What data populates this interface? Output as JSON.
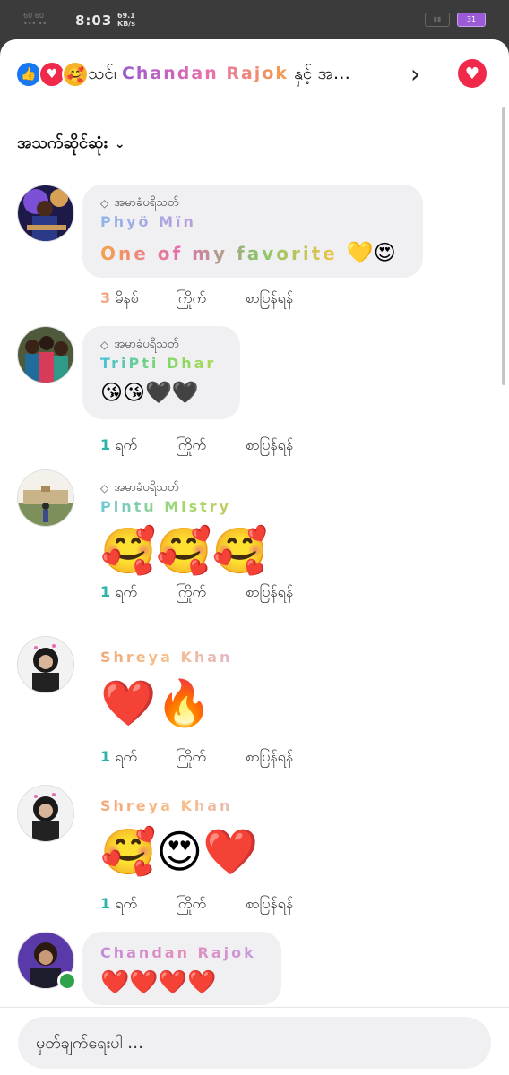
{
  "status_bar": {
    "left_small": "60 60\n••• ••",
    "time": "8:03",
    "net_speed_value": "69.1",
    "net_speed_unit": "KB/s",
    "battery": "31"
  },
  "header": {
    "reactions": [
      {
        "icon": "like-icon",
        "glyph": "👍"
      },
      {
        "icon": "love-icon",
        "glyph": "♥"
      },
      {
        "icon": "care-icon",
        "glyph": "🥰"
      }
    ],
    "title_prefix": "သင်၊",
    "title_name": "Chandan Rajok",
    "title_suffix": "နှင့် အ…",
    "chevron": "›",
    "heart_glyph": "♥",
    "accent": "#f0284a"
  },
  "sort": {
    "label": "အသက်ဆိုင်ဆုံး",
    "chevron": "⌄"
  },
  "badge_label": "အမာခံပရိသတ်",
  "actions": {
    "like": "ကြိုက်",
    "reply": "စာပြန်ရန်"
  },
  "comments": [
    {
      "name": "Phyö Mïn",
      "text": "One of my favorite",
      "emoji": "💛😍",
      "time_num": "3",
      "time_unit": "မိနစ်",
      "badge": true
    },
    {
      "name": "TriPti Dhar",
      "text": "",
      "emoji": "😘😘🖤🖤",
      "time_num": "1",
      "time_unit": "ရက်",
      "badge": true
    },
    {
      "name": "Pintu Mistry",
      "text": "",
      "emoji": "🥰🥰🥰",
      "time_num": "1",
      "time_unit": "ရက်",
      "badge": true
    },
    {
      "name": "Shreya Khan",
      "text": "",
      "emoji": "❤️🔥",
      "time_num": "1",
      "time_unit": "ရက်",
      "badge": false
    },
    {
      "name": "Shreya Khan",
      "text": "",
      "emoji": "🥰😍❤️",
      "time_num": "1",
      "time_unit": "ရက်",
      "badge": false
    },
    {
      "name": "Chandan Rajok",
      "text": "",
      "emoji": "❤️❤️❤️❤️",
      "badge": false
    }
  ],
  "composer": {
    "placeholder": "မှတ်ချက်ရေးပါ …"
  }
}
